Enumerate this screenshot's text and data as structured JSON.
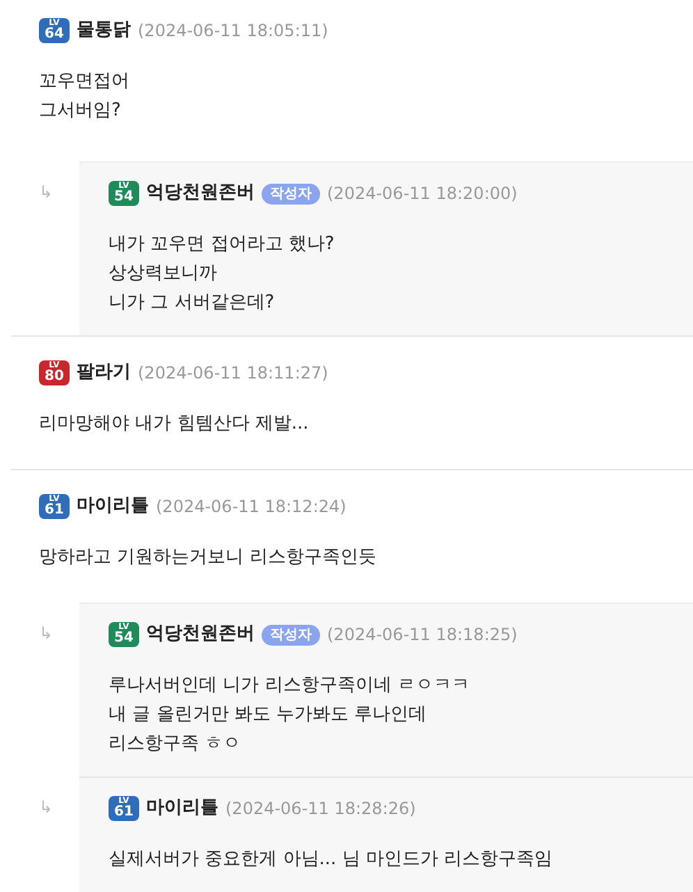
{
  "comments": [
    {
      "kind": "comment",
      "badge": {
        "label": "LV",
        "number": "64",
        "color": "#2f6db8"
      },
      "author": "물통닭",
      "time": "(2024-06-11 18:05:11)",
      "lines": [
        "꼬우면접어",
        "그서버임?"
      ]
    },
    {
      "kind": "reply",
      "reply_mark": "↳",
      "badge": {
        "label": "LV",
        "number": "54",
        "color": "#1f8a5a"
      },
      "author": "억당천원존버",
      "author_tag": "작성자",
      "time": "(2024-06-11 18:20:00)",
      "lines": [
        "내가 꼬우면 접어라고 했나?",
        "상상력보니까",
        "니가 그 서버같은데?"
      ]
    },
    {
      "kind": "comment",
      "badge": {
        "label": "LV",
        "number": "80",
        "color": "#c8282d"
      },
      "author": "팔라기",
      "time": "(2024-06-11 18:11:27)",
      "lines": [
        "리마망해야 내가 힘템산다 제발..."
      ]
    },
    {
      "kind": "comment",
      "badge": {
        "label": "LV",
        "number": "61",
        "color": "#2f6db8"
      },
      "author": "마이리틀",
      "time": "(2024-06-11 18:12:24)",
      "lines": [
        "망하라고 기원하는거보니 리스항구족인듯"
      ]
    },
    {
      "kind": "reply",
      "reply_mark": "↳",
      "badge": {
        "label": "LV",
        "number": "54",
        "color": "#1f8a5a"
      },
      "author": "억당천원존버",
      "author_tag": "작성자",
      "time": "(2024-06-11 18:18:25)",
      "lines": [
        "루나서버인데 니가 리스항구족이네 ㄹㅇㅋㅋ",
        "내 글 올린거만 봐도 누가봐도 루나인데",
        "리스항구족 ㅎㅇ"
      ]
    },
    {
      "kind": "reply",
      "reply_mark": "↳",
      "badge": {
        "label": "LV",
        "number": "61",
        "color": "#2f6db8"
      },
      "author": "마이리틀",
      "time": "(2024-06-11 18:28:26)",
      "lines": [
        "실제서버가 중요한게 아님... 님 마인드가 리스항구족임"
      ]
    }
  ]
}
